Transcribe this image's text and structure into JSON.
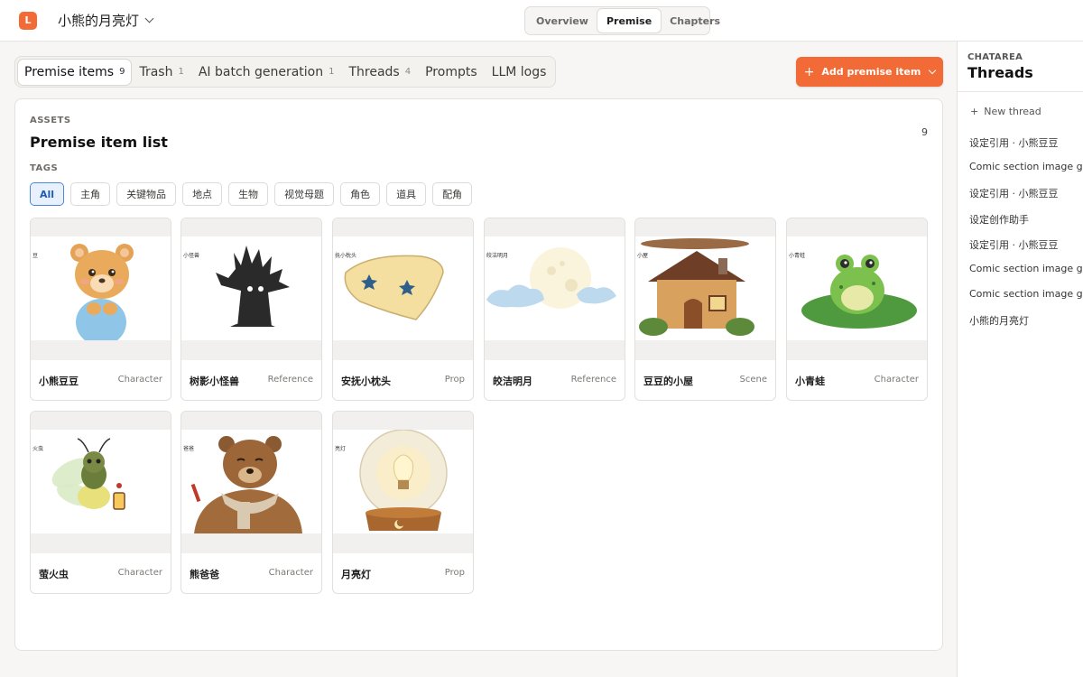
{
  "header": {
    "logo_letter": "L",
    "project_title": "小熊的月亮灯",
    "segments": [
      {
        "label": "Overview",
        "active": false
      },
      {
        "label": "Premise",
        "active": true
      },
      {
        "label": "Chapters",
        "active": false
      }
    ]
  },
  "tabs": [
    {
      "label": "Premise items",
      "count": "9",
      "active": true
    },
    {
      "label": "Trash",
      "count": "1",
      "active": false
    },
    {
      "label": "AI batch generation",
      "count": "1",
      "active": false
    },
    {
      "label": "Threads",
      "count": "4",
      "active": false
    },
    {
      "label": "Prompts",
      "count": "",
      "active": false
    },
    {
      "label": "LLM logs",
      "count": "",
      "active": false
    }
  ],
  "add_button": {
    "label": "Add premise item"
  },
  "assets": {
    "eyebrow": "ASSETS",
    "title": "Premise item list",
    "count": "9",
    "tags_label": "TAGS",
    "tags": [
      {
        "label": "All",
        "active": true
      },
      {
        "label": "主角",
        "active": false
      },
      {
        "label": "关键物品",
        "active": false
      },
      {
        "label": "地点",
        "active": false
      },
      {
        "label": "生物",
        "active": false
      },
      {
        "label": "视觉母题",
        "active": false
      },
      {
        "label": "角色",
        "active": false
      },
      {
        "label": "道具",
        "active": false
      },
      {
        "label": "配角",
        "active": false
      }
    ],
    "items": [
      {
        "name": "小熊豆豆",
        "type": "Character",
        "icon": "bear-cub-icon",
        "thumb_label": "豆"
      },
      {
        "name": "树影小怪兽",
        "type": "Reference",
        "icon": "tree-shadow-monster-icon",
        "thumb_label": "小怪兽"
      },
      {
        "name": "安抚小枕头",
        "type": "Prop",
        "icon": "pillow-icon",
        "thumb_label": "抚小枕头"
      },
      {
        "name": "皎洁明月",
        "type": "Reference",
        "icon": "moon-icon",
        "thumb_label": "皎洁明月"
      },
      {
        "name": "豆豆的小屋",
        "type": "Scene",
        "icon": "cottage-icon",
        "thumb_label": "小屋"
      },
      {
        "name": "小青蛙",
        "type": "Character",
        "icon": "frog-icon",
        "thumb_label": "小青蛙"
      },
      {
        "name": "萤火虫",
        "type": "Character",
        "icon": "firefly-icon",
        "thumb_label": "火虫"
      },
      {
        "name": "熊爸爸",
        "type": "Character",
        "icon": "papa-bear-icon",
        "thumb_label": "爸爸"
      },
      {
        "name": "月亮灯",
        "type": "Prop",
        "icon": "moon-lamp-icon",
        "thumb_label": "亮灯"
      }
    ]
  },
  "chatarea": {
    "eyebrow": "CHATAREA",
    "title": "Threads",
    "new_thread": "New thread",
    "threads": [
      "设定引用 · 小熊豆豆",
      "Comic section image ger",
      "设定引用 · 小熊豆豆",
      "设定创作助手",
      "设定引用 · 小熊豆豆",
      "Comic section image ger",
      "Comic section image ger",
      "小熊的月亮灯"
    ]
  },
  "colors": {
    "accent": "#f26a35",
    "tag_active_bg": "#e8f0fc",
    "tag_active_border": "#4f86d8"
  }
}
